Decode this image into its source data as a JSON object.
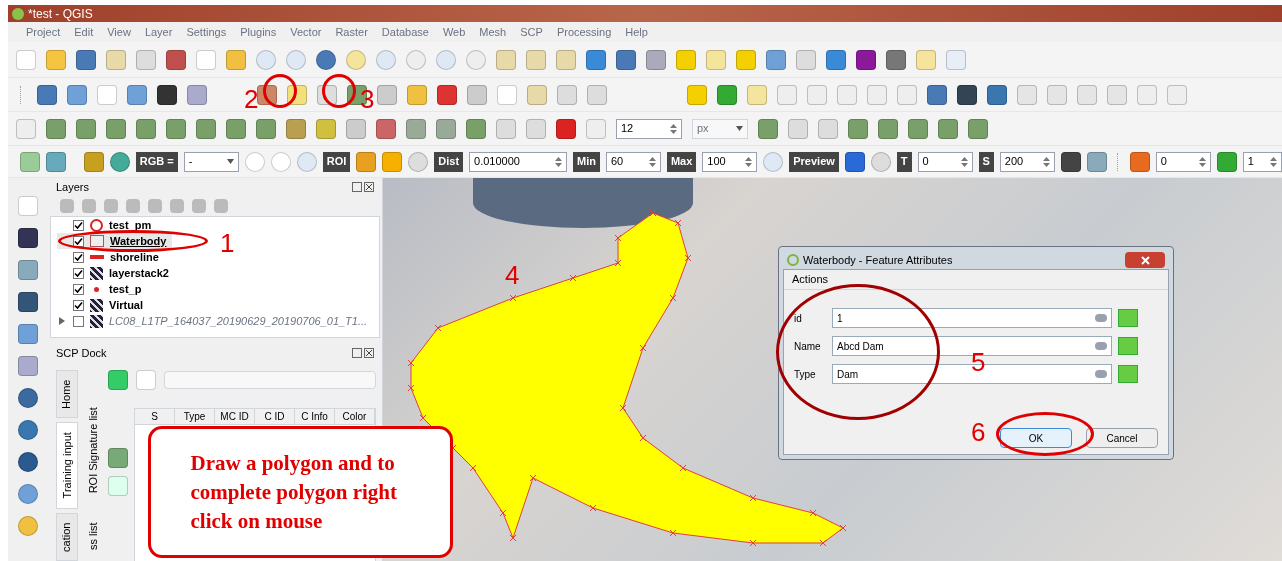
{
  "window": {
    "title": "*test - QGIS"
  },
  "menu": [
    "Project",
    "Edit",
    "View",
    "Layer",
    "Settings",
    "Plugins",
    "Vector",
    "Raster",
    "Database",
    "Web",
    "Mesh",
    "SCP",
    "Processing",
    "Help"
  ],
  "snapping_toolbar": {
    "tolerance": "12",
    "unit": "px"
  },
  "scp_toolbar": {
    "rgb_label": "RGB =",
    "rgb_value": "-",
    "roi_label": "ROI",
    "dist_label": "Dist",
    "dist_value": "0.010000",
    "min_label": "Min",
    "min_value": "60",
    "max_label": "Max",
    "max_value": "100",
    "preview_label": "Preview",
    "t_label": "T",
    "t_value": "0",
    "s_label": "S",
    "s_value": "200",
    "band_value": "0",
    "step_value": "1"
  },
  "layers_panel": {
    "title": "Layers",
    "layers": [
      {
        "name": "test_pm",
        "checked": true,
        "selected": false,
        "kind": "point"
      },
      {
        "name": "Waterbody",
        "checked": true,
        "selected": true,
        "kind": "polygon"
      },
      {
        "name": "shoreline",
        "checked": true,
        "selected": false,
        "kind": "line"
      },
      {
        "name": "layerstack2",
        "checked": true,
        "selected": false,
        "kind": "raster"
      },
      {
        "name": "test_p",
        "checked": true,
        "selected": false,
        "kind": "dot"
      },
      {
        "name": "Virtual",
        "checked": true,
        "selected": false,
        "kind": "raster"
      },
      {
        "name": "LC08_L1TP_164037_20190629_20190706_01_T1...",
        "checked": false,
        "selected": false,
        "kind": "raster",
        "expanded": false
      }
    ]
  },
  "scp_dock": {
    "title": "SCP Dock",
    "tabs": [
      {
        "label": "Home",
        "selected": false
      },
      {
        "label": "Training input",
        "selected": true
      },
      {
        "label": "cation",
        "selected": false
      }
    ],
    "subtabs": [
      "ROI Signature list",
      "ss list"
    ],
    "columns": [
      "S",
      "Type",
      "MC ID",
      "C ID",
      "C Info",
      "Color"
    ]
  },
  "dialog": {
    "title": "Waterbody - Feature Attributes",
    "menu": "Actions",
    "fields": [
      {
        "label": "id",
        "value": "1"
      },
      {
        "label": "Name",
        "value": "Abcd Dam"
      },
      {
        "label": "Type",
        "value": "Dam"
      }
    ],
    "buttons": [
      "OK",
      "Cancel"
    ]
  },
  "annotations": {
    "steps": [
      "1",
      "2",
      "3",
      "4",
      "5",
      "6"
    ],
    "callout": "Draw a polygon and to complete polygon right click on mouse"
  }
}
